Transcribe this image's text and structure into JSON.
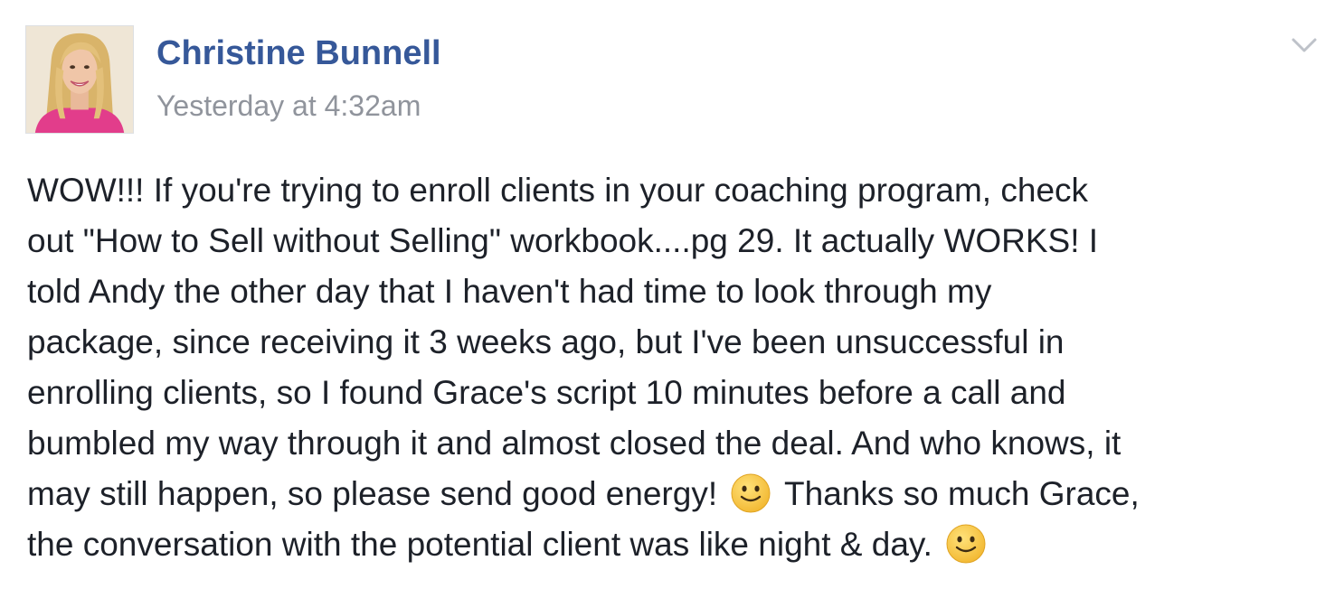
{
  "post": {
    "author": "Christine Bunnell",
    "timestamp": "Yesterday at 4:32am",
    "options_icon": "chevron-down-icon",
    "avatar": "profile-photo",
    "text_lines": [
      {
        "a": "WOW!!! If you're trying to enroll clients in your coaching program, check"
      },
      {
        "a": "out \"How to Sell without Selling\" workbook....pg 29. It actually WORKS! I"
      },
      {
        "a": "told Andy the other day that I haven't had time to look through my"
      },
      {
        "a": "package, since receiving it 3 weeks ago, but I've been unsuccessful in"
      },
      {
        "a": "enrolling clients, so I found Grace's script 10 minutes before a call and"
      },
      {
        "a": "bumbled my way through it and almost closed the deal. And who knows, it"
      },
      {
        "a": "may still happen, so please send good energy!",
        "emoji": "slightly-smiling-face-icon",
        "b": "Thanks so much Grace,"
      },
      {
        "a": "the conversation with the potential client was like night & day.",
        "emoji": "slightly-smiling-face-icon"
      }
    ]
  },
  "colors": {
    "author": "#365899",
    "timestamp": "#90949c",
    "text": "#1d2129",
    "emoji_face": "#f7c948"
  }
}
